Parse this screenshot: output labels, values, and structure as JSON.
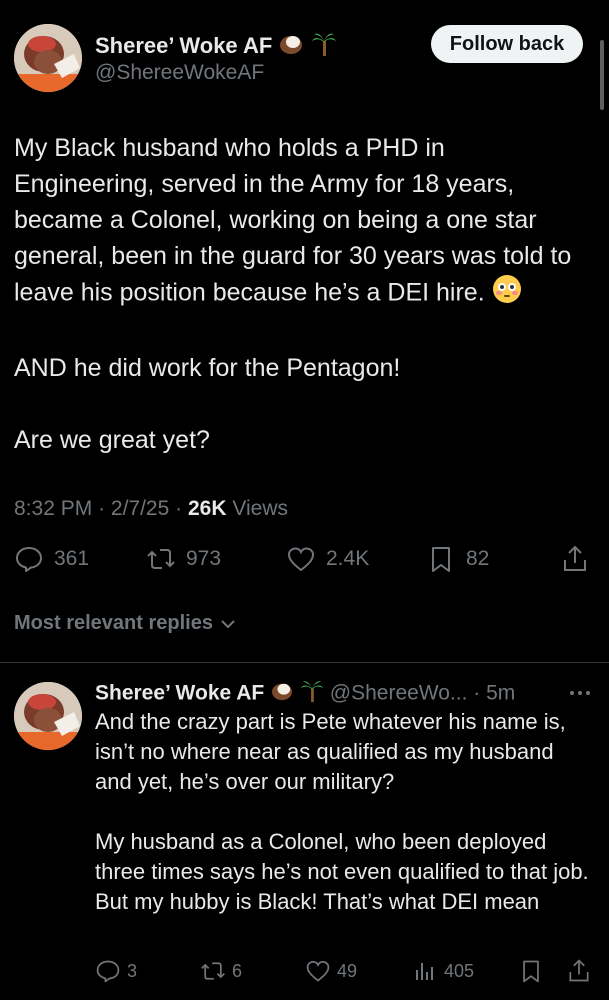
{
  "tweet": {
    "author_name": "Sheree’ Woke AF",
    "author_handle": "@ShereeWokeAF",
    "follow_label": "Follow back",
    "paragraphs": [
      "My Black husband who holds a PHD in Engineering, served in the Army for 18 years, became a Colonel, working on being a one star general, been in the guard for 30 years was told to leave his position because he’s a DEI hire.",
      "AND he did work for the Pentagon!",
      "Are we great yet?"
    ],
    "time": "8:32 PM",
    "date": "2/7/25",
    "views_count": "26K",
    "views_label": "Views",
    "sep": "·",
    "stats": {
      "replies": "361",
      "reposts": "973",
      "likes": "2.4K",
      "bookmarks": "82"
    }
  },
  "replies_header": {
    "label": "Most relevant replies"
  },
  "reply": {
    "author_name": "Sheree’ Woke AF",
    "author_handle_short": "@ShereeWo...",
    "sep": "·",
    "time_ago": "5m",
    "paragraphs": [
      "And the crazy part is Pete whatever his name is, isn’t no where near as qualified as my husband and yet, he’s over our military?",
      "My husband as a Colonel, who been deployed three times says he’s not even qualified to that job. But my hubby is Black! That’s what DEI mean"
    ],
    "stats": {
      "replies": "3",
      "reposts": "6",
      "likes": "49",
      "views": "405"
    }
  },
  "icons": {
    "badges": [
      "coconut-icon",
      "palm-tree-icon"
    ],
    "emoji": "flushed-face-icon"
  },
  "colors": {
    "background": "#000000",
    "text": "#e7e9ea",
    "muted": "#71767b",
    "divider": "#2f3336",
    "button_bg": "#eff3f4"
  }
}
